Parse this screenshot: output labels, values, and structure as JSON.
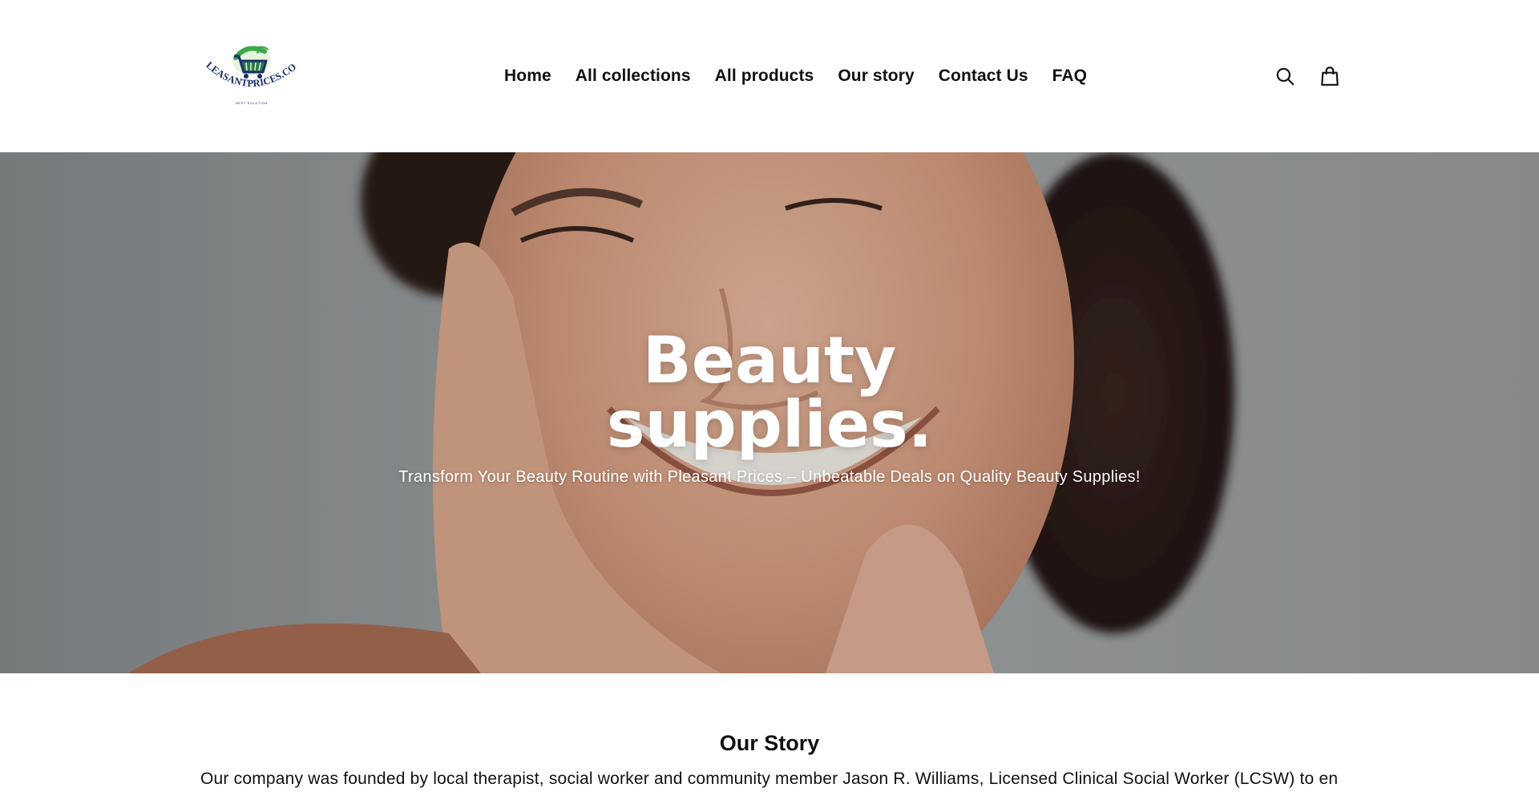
{
  "header": {
    "logo_text": "PLEASANTPRICES.COM",
    "logo_tagline": "BEST SOLUTION",
    "nav": [
      {
        "label": "Home"
      },
      {
        "label": "All collections"
      },
      {
        "label": "All products"
      },
      {
        "label": "Our story"
      },
      {
        "label": "Contact Us"
      },
      {
        "label": "FAQ"
      }
    ],
    "icons": {
      "search": "search-icon",
      "cart": "cart-icon"
    }
  },
  "hero": {
    "title_line1": "Beauty",
    "title_line2": "supplies.",
    "subtitle": "Transform Your Beauty Routine with Pleasant Prices – Unbeatable Deals on Quality Beauty Supplies!"
  },
  "story": {
    "title": "Our Story",
    "text": "Our company was founded by local therapist, social worker and community member Jason R. Williams, Licensed Clinical Social Worker (LCSW) to ensure the autistic"
  },
  "colors": {
    "logo_green": "#3aa84a",
    "logo_navy": "#1c2f6b",
    "text": "#111111",
    "hero_text": "#ffffff"
  }
}
